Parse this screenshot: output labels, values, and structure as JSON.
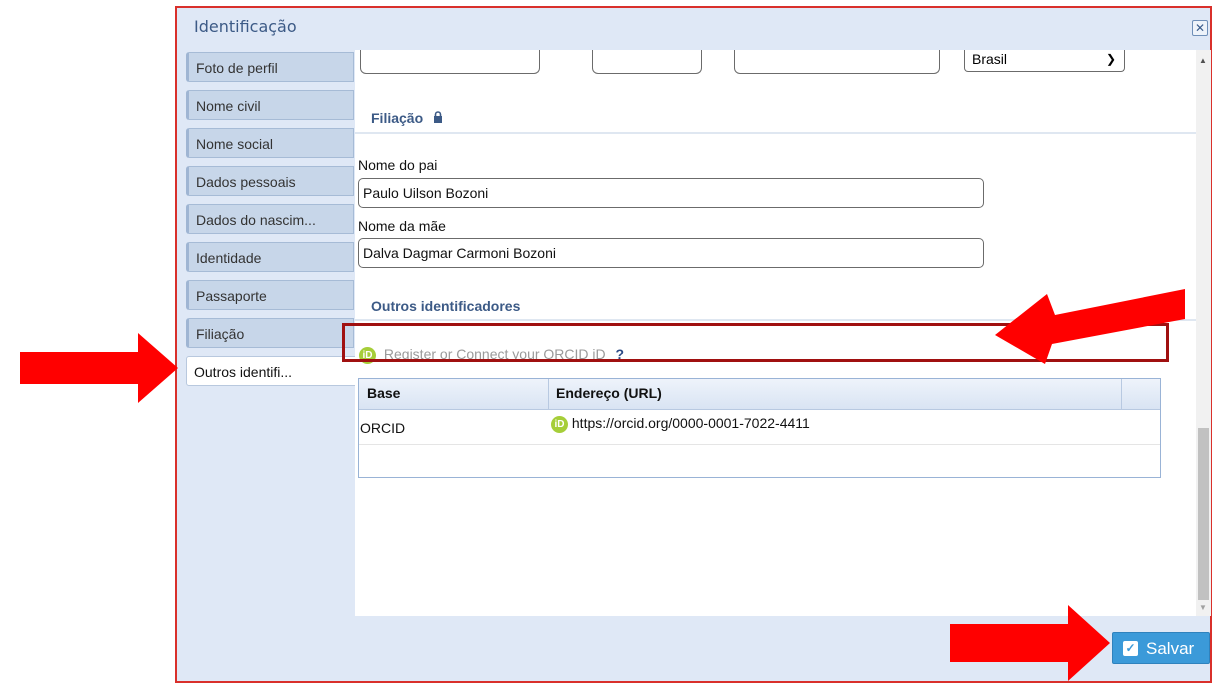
{
  "dialog": {
    "title": "Identificação",
    "close_icon": "collapse-x-icon"
  },
  "tabs": [
    {
      "label": "Foto de perfil"
    },
    {
      "label": "Nome civil"
    },
    {
      "label": "Nome social"
    },
    {
      "label": "Dados pessoais"
    },
    {
      "label": "Dados do nascim..."
    },
    {
      "label": "Identidade"
    },
    {
      "label": "Passaporte"
    },
    {
      "label": "Filiação"
    },
    {
      "label": "Outros identifi...",
      "active": true
    }
  ],
  "top_row": {
    "country_value": "Brasil"
  },
  "filiacao": {
    "title": "Filiação",
    "father_label": "Nome do pai",
    "father_value": "Paulo Uilson Bozoni",
    "mother_label": "Nome da mãe",
    "mother_value": "Dalva Dagmar Carmoni Bozoni"
  },
  "outros": {
    "title": "Outros identificadores",
    "orcid_icon_text": "iD",
    "orcid_link": "Register or Connect your ORCID iD",
    "help": "?",
    "grid": {
      "columns": [
        "Base",
        "Endereço (URL)"
      ],
      "rows": [
        {
          "base": "ORCID",
          "url": "https://orcid.org/0000-0001-7022-4411"
        }
      ]
    }
  },
  "footer": {
    "save_label": "Salvar"
  },
  "colors": {
    "annotation_red": "#ff0000",
    "highlight_border": "#a01010",
    "save_button": "#3b9ad9",
    "orcid_green": "#a6ce39",
    "section_title": "#3c5a86"
  }
}
